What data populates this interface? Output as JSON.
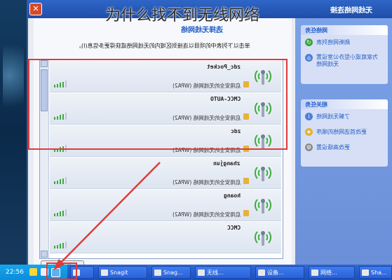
{
  "headline": "为什么找不到无线网络",
  "window": {
    "title": "无线网络连接"
  },
  "content": {
    "section_title": "选择无线网络",
    "instruction": "单击以下列表中的项目以连接到区域内的无线网络或获得更多信息(I)。"
  },
  "networks": [
    {
      "name": "zdc_Pocket",
      "security": "启用安全的无线网络 (WPA2)",
      "signal": 4
    },
    {
      "name": "CMCC-AUTO",
      "security": "启用安全的无线网络 (WPA2)",
      "signal": 4
    },
    {
      "name": "zdc",
      "security": "启用安全的无线网络 (WPA2)",
      "signal": 4
    },
    {
      "name": "zhangjun",
      "security": "启用安全的无线网络 (WPA2)",
      "signal": 4
    },
    {
      "name": "hoang",
      "security": "启用安全的无线网络 (WPA2)",
      "signal": 4
    },
    {
      "name": "CMCC",
      "security": "",
      "signal": 4
    }
  ],
  "connect_button": "连接(C)",
  "sidebar": {
    "network_tasks": {
      "title": "网络任务",
      "items": [
        "刷新网络列表",
        "为家庭或小型办公室设置无线网络"
      ]
    },
    "related_tasks": {
      "title": "相关任务",
      "items": [
        "了解无线网络",
        "更改首选网络的顺序",
        "更改高级设置"
      ]
    }
  },
  "taskbar": {
    "clock": "22:56",
    "items": [
      "Snagit",
      "Snag...",
      "无线...",
      "设备...",
      "网络...",
      "Sha..."
    ]
  },
  "colors": {
    "accent": "#215dc6",
    "highlight": "#e03a3a",
    "signal": "#3dab3d"
  }
}
